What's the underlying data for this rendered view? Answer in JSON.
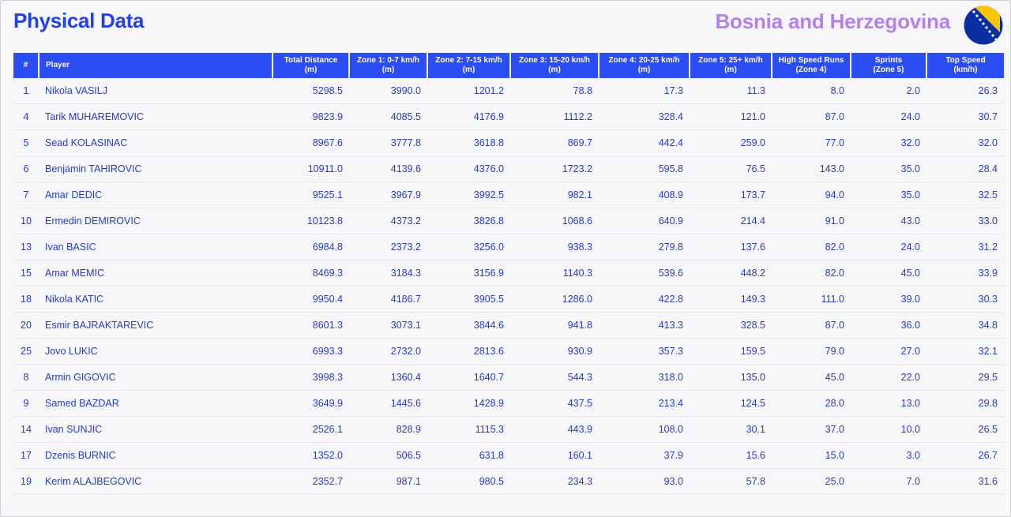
{
  "header": {
    "title": "Physical Data",
    "team": "Bosnia and Herzegovina",
    "flag_icon": "bosnia-herzegovina-flag",
    "colors": {
      "title": "#2340f0",
      "team": "#b57ff0",
      "header_bg": "#2a4df5",
      "text": "#2a3db8"
    }
  },
  "table": {
    "columns": [
      [
        "#",
        ""
      ],
      [
        "Player",
        ""
      ],
      [
        "Total Distance",
        "(m)"
      ],
      [
        "Zone 1: 0-7 km/h",
        "(m)"
      ],
      [
        "Zone 2: 7-15 km/h",
        "(m)"
      ],
      [
        "Zone 3: 15-20 km/h",
        "(m)"
      ],
      [
        "Zone 4: 20-25 km/h",
        "(m)"
      ],
      [
        "Zone 5: 25+ km/h",
        "(m)"
      ],
      [
        "High Speed Runs",
        "(Zone 4)"
      ],
      [
        "Sprints",
        "(Zone 5)"
      ],
      [
        "Top Speed",
        "(km/h)"
      ]
    ],
    "rows": [
      [
        "1",
        "Nikola VASILJ",
        "5298.5",
        "3990.0",
        "1201.2",
        "78.8",
        "17.3",
        "11.3",
        "8.0",
        "2.0",
        "26.3"
      ],
      [
        "4",
        "Tarik MUHAREMOVIC",
        "9823.9",
        "4085.5",
        "4176.9",
        "1112.2",
        "328.4",
        "121.0",
        "87.0",
        "24.0",
        "30.7"
      ],
      [
        "5",
        "Sead KOLASINAC",
        "8967.6",
        "3777.8",
        "3618.8",
        "869.7",
        "442.4",
        "259.0",
        "77.0",
        "32.0",
        "32.0"
      ],
      [
        "6",
        "Benjamin TAHIROVIC",
        "10911.0",
        "4139.6",
        "4376.0",
        "1723.2",
        "595.8",
        "76.5",
        "143.0",
        "35.0",
        "28.4"
      ],
      [
        "7",
        "Amar DEDIC",
        "9525.1",
        "3967.9",
        "3992.5",
        "982.1",
        "408.9",
        "173.7",
        "94.0",
        "35.0",
        "32.5"
      ],
      [
        "10",
        "Ermedin DEMIROVIC",
        "10123.8",
        "4373.2",
        "3826.8",
        "1068.6",
        "640.9",
        "214.4",
        "91.0",
        "43.0",
        "33.0"
      ],
      [
        "13",
        "Ivan BASIC",
        "6984.8",
        "2373.2",
        "3256.0",
        "938.3",
        "279.8",
        "137.6",
        "82.0",
        "24.0",
        "31.2"
      ],
      [
        "15",
        "Amar MEMIC",
        "8469.3",
        "3184.3",
        "3156.9",
        "1140.3",
        "539.6",
        "448.2",
        "82.0",
        "45.0",
        "33.9"
      ],
      [
        "18",
        "Nikola KATIC",
        "9950.4",
        "4186.7",
        "3905.5",
        "1286.0",
        "422.8",
        "149.3",
        "111.0",
        "39.0",
        "30.3"
      ],
      [
        "20",
        "Esmir BAJRAKTAREVIC",
        "8601.3",
        "3073.1",
        "3844.6",
        "941.8",
        "413.3",
        "328.5",
        "87.0",
        "36.0",
        "34.8"
      ],
      [
        "25",
        "Jovo LUKIC",
        "6993.3",
        "2732.0",
        "2813.6",
        "930.9",
        "357.3",
        "159.5",
        "79.0",
        "27.0",
        "32.1"
      ],
      [
        "8",
        "Armin GIGOVIC",
        "3998.3",
        "1360.4",
        "1640.7",
        "544.3",
        "318.0",
        "135.0",
        "45.0",
        "22.0",
        "29.5"
      ],
      [
        "9",
        "Samed BAZDAR",
        "3649.9",
        "1445.6",
        "1428.9",
        "437.5",
        "213.4",
        "124.5",
        "28.0",
        "13.0",
        "29.8"
      ],
      [
        "14",
        "Ivan SUNJIC",
        "2526.1",
        "828.9",
        "1115.3",
        "443.9",
        "108.0",
        "30.1",
        "37.0",
        "10.0",
        "26.5"
      ],
      [
        "17",
        "Dzenis BURNIC",
        "1352.0",
        "506.5",
        "631.8",
        "160.1",
        "37.9",
        "15.6",
        "15.0",
        "3.0",
        "26.7"
      ],
      [
        "19",
        "Kerim ALAJBEGOVIC",
        "2352.7",
        "987.1",
        "980.5",
        "234.3",
        "93.0",
        "57.8",
        "25.0",
        "7.0",
        "31.6"
      ]
    ]
  }
}
